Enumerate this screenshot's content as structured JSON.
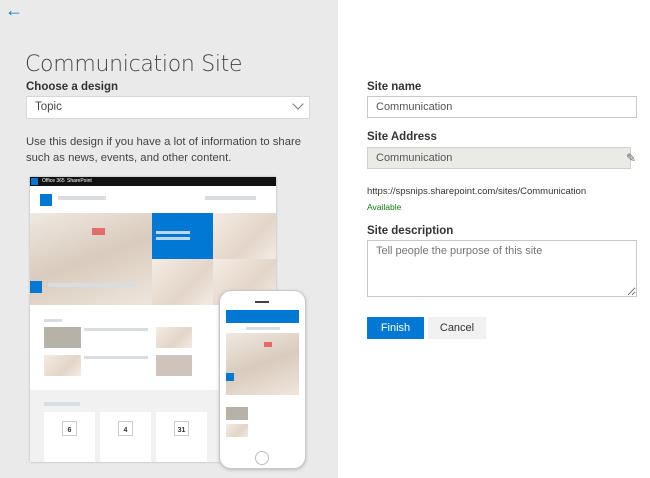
{
  "header": {
    "back_icon": "arrow-left-icon"
  },
  "left": {
    "title": "Communication Site",
    "design_label": "Choose a design",
    "design_value": "Topic",
    "description": "Use this design if you have a lot of information to share such as news, events, and other content.",
    "preview": {
      "suite": "Office 365",
      "app": "SharePoint",
      "event_dates": [
        "6",
        "4",
        "31"
      ]
    }
  },
  "form": {
    "site_name_label": "Site name",
    "site_name_value": "Communication",
    "site_address_label": "Site Address",
    "site_address_value": "Communication",
    "url": "https://spsnips.sharepoint.com/sites/Communication",
    "availability": "Available",
    "site_description_label": "Site description",
    "site_description_placeholder": "Tell people the purpose of this site",
    "finish": "Finish",
    "cancel": "Cancel"
  },
  "colors": {
    "accent": "#0078d4",
    "available": "#107c10"
  }
}
